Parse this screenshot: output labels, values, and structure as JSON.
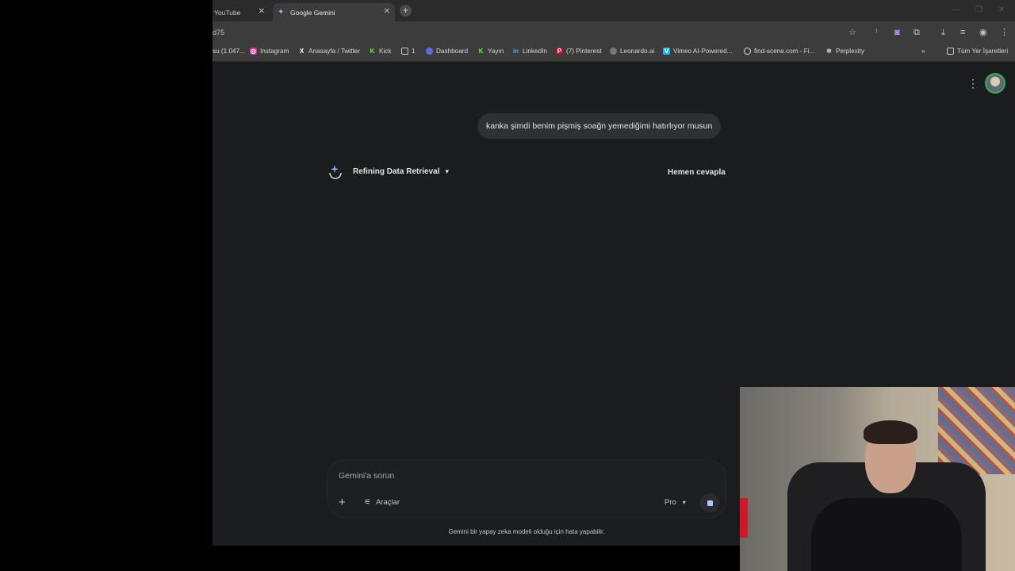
{
  "tabs": [
    {
      "label": "YouTube",
      "active": false
    },
    {
      "label": "Google Gemini",
      "active": true
    }
  ],
  "toolbar": {
    "url_fragment": "d75"
  },
  "bookmarks": {
    "items": [
      {
        "label": "su (1.047...",
        "icon": "bookmark-icon"
      },
      {
        "label": "Instagram",
        "icon": "instagram-icon"
      },
      {
        "label": "Anasayfa / Twitter",
        "icon": "x-icon"
      },
      {
        "label": "Kick",
        "icon": "kick-icon"
      },
      {
        "label": "1",
        "icon": "folder-icon"
      },
      {
        "label": "Dashboard",
        "icon": "dashboard-icon"
      },
      {
        "label": "Yayın",
        "icon": "kick-icon"
      },
      {
        "label": "LinkedIn",
        "icon": "linkedin-icon"
      },
      {
        "label": "(7) Pinterest",
        "icon": "pinterest-icon"
      },
      {
        "label": "Leonardo.ai",
        "icon": "leonardo-icon"
      },
      {
        "label": "Vimeo AI-Powered...",
        "icon": "vimeo-icon"
      },
      {
        "label": "find-scene.com - Fi...",
        "icon": "findscene-icon"
      },
      {
        "label": "Perplexity",
        "icon": "perplexity-icon"
      }
    ],
    "all_bookmarks": "Tüm Yer İşaretleri"
  },
  "chat": {
    "user_message": "kanka şimdi benim pişmiş soağn yemediğimi hatırlıyor musun",
    "thinking_label": "Refining Data Retrieval",
    "answer_now": "Hemen cevapla"
  },
  "composer": {
    "placeholder": "Gemini'a sorun",
    "tools_label": "Araçlar",
    "model_label": "Pro",
    "disclaimer": "Gemini bir yapay zeka modeli olduğu için hata yapabilir."
  },
  "colors": {
    "page_bg": "#1b1c1d",
    "bubble_bg": "#2e3032",
    "accent": "#a8c7fa"
  }
}
